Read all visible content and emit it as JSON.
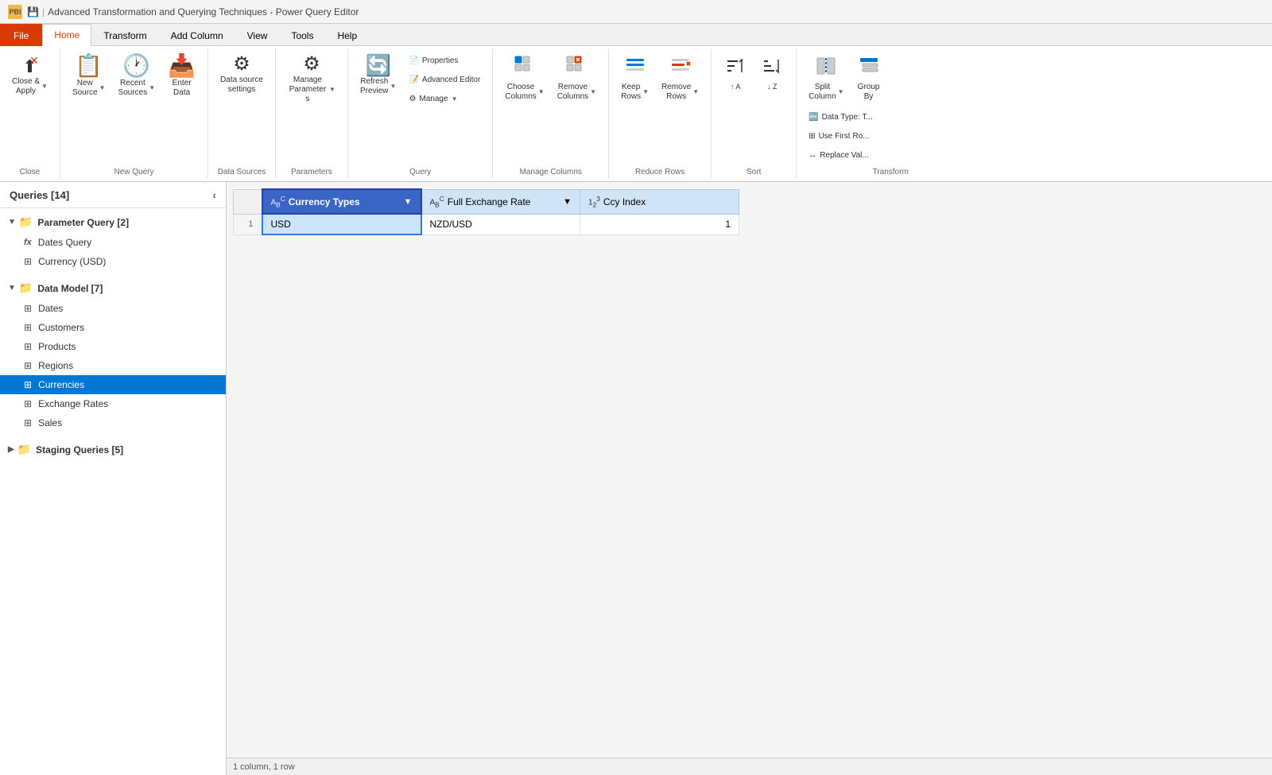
{
  "app": {
    "title": "Advanced Transformation and Querying Techniques - Power Query Editor",
    "logo": "PBI"
  },
  "top_ribbon_icons": [
    "🗃",
    "📊",
    "📋",
    "📁",
    "🔲",
    "⚙",
    "📅",
    "📊",
    "🔗",
    "📈",
    "🔤",
    "🖊",
    "🔢",
    "⚡",
    "🗂",
    "👤"
  ],
  "tabs": [
    {
      "id": "file",
      "label": "File",
      "active": false,
      "is_file": true
    },
    {
      "id": "home",
      "label": "Home",
      "active": true,
      "is_file": false
    },
    {
      "id": "transform",
      "label": "Transform",
      "active": false,
      "is_file": false
    },
    {
      "id": "add_column",
      "label": "Add Column",
      "active": false,
      "is_file": false
    },
    {
      "id": "view",
      "label": "View",
      "active": false,
      "is_file": false
    },
    {
      "id": "tools",
      "label": "Tools",
      "active": false,
      "is_file": false
    },
    {
      "id": "help",
      "label": "Help",
      "active": false,
      "is_file": false
    }
  ],
  "ribbon": {
    "groups": [
      {
        "id": "close",
        "label": "Close",
        "buttons": [
          {
            "id": "close-apply",
            "icon": "✕",
            "label": "Close &\nApply",
            "dropdown": true,
            "large": true
          }
        ]
      },
      {
        "id": "new-query",
        "label": "New Query",
        "buttons": [
          {
            "id": "new-source",
            "icon": "📋",
            "label": "New\nSource",
            "dropdown": true,
            "large": true
          },
          {
            "id": "recent-sources",
            "icon": "🕐",
            "label": "Recent\nSources",
            "dropdown": true,
            "large": true
          },
          {
            "id": "enter-data",
            "icon": "📥",
            "label": "Enter\nData",
            "large": true
          }
        ]
      },
      {
        "id": "data-sources",
        "label": "Data Sources",
        "buttons": [
          {
            "id": "data-source-settings",
            "icon": "⚙",
            "label": "Data source\nsettings",
            "large": true
          }
        ]
      },
      {
        "id": "parameters",
        "label": "Parameters",
        "buttons": [
          {
            "id": "manage-parameters",
            "icon": "⚙",
            "label": "Manage\nParameters",
            "dropdown": true,
            "large": true
          }
        ]
      },
      {
        "id": "query",
        "label": "Query",
        "buttons": [
          {
            "id": "refresh-preview",
            "icon": "🔄",
            "label": "Refresh\nPreview",
            "dropdown": true,
            "large": true
          },
          {
            "id": "properties",
            "icon": "📄",
            "label": "Properties",
            "small": true
          },
          {
            "id": "advanced-editor",
            "icon": "📝",
            "label": "Advanced Editor",
            "small": true
          },
          {
            "id": "manage",
            "icon": "⚙",
            "label": "Manage",
            "dropdown": true,
            "small": true
          }
        ]
      },
      {
        "id": "manage-columns",
        "label": "Manage Columns",
        "buttons": [
          {
            "id": "choose-columns",
            "icon": "⊞",
            "label": "Choose\nColumns",
            "dropdown": true,
            "large": true
          },
          {
            "id": "remove-columns",
            "icon": "✕",
            "label": "Remove\nColumns",
            "dropdown": true,
            "large": true
          }
        ]
      },
      {
        "id": "reduce-rows",
        "label": "Reduce Rows",
        "buttons": [
          {
            "id": "keep-rows",
            "icon": "≡",
            "label": "Keep\nRows",
            "dropdown": true,
            "large": true
          },
          {
            "id": "remove-rows",
            "icon": "✕",
            "label": "Remove\nRows",
            "dropdown": true,
            "large": true,
            "active": true
          }
        ]
      },
      {
        "id": "sort",
        "label": "Sort",
        "buttons": [
          {
            "id": "sort-asc",
            "icon": "↑",
            "label": "Sort\nAsc",
            "large": true
          },
          {
            "id": "sort-desc",
            "icon": "↓",
            "label": "Sort\nDesc",
            "large": true
          }
        ]
      },
      {
        "id": "transform",
        "label": "Transform",
        "buttons": [
          {
            "id": "split-column",
            "icon": "⫘",
            "label": "Split\nColumn",
            "dropdown": true,
            "large": true
          },
          {
            "id": "group-by",
            "icon": "⊟",
            "label": "Group\nBy",
            "large": true
          },
          {
            "id": "data-type",
            "icon": "🔤",
            "label": "Data Type: T",
            "small": true
          },
          {
            "id": "use-first-row",
            "icon": "⊞",
            "label": "Use First...",
            "small": true
          },
          {
            "id": "replace-values",
            "icon": "↔",
            "label": "Replace",
            "small": true
          }
        ]
      }
    ]
  },
  "sidebar": {
    "title": "Queries [14]",
    "groups": [
      {
        "id": "parameter-query",
        "label": "Parameter Query [2]",
        "expanded": true,
        "items": [
          {
            "id": "dates-query",
            "label": "Dates Query",
            "type": "fx"
          },
          {
            "id": "currency-usd",
            "label": "Currency (USD)",
            "type": "table"
          }
        ]
      },
      {
        "id": "data-model",
        "label": "Data Model [7]",
        "expanded": true,
        "items": [
          {
            "id": "dates",
            "label": "Dates",
            "type": "table"
          },
          {
            "id": "customers",
            "label": "Customers",
            "type": "table"
          },
          {
            "id": "products",
            "label": "Products",
            "type": "table"
          },
          {
            "id": "regions",
            "label": "Regions",
            "type": "table"
          },
          {
            "id": "currencies",
            "label": "Currencies",
            "type": "table",
            "active": true
          },
          {
            "id": "exchange-rates",
            "label": "Exchange Rates",
            "type": "table"
          },
          {
            "id": "sales",
            "label": "Sales",
            "type": "table"
          }
        ]
      },
      {
        "id": "staging-queries",
        "label": "Staging Queries [5]",
        "expanded": false,
        "items": []
      }
    ]
  },
  "table": {
    "columns": [
      {
        "id": "currency-types",
        "label": "Currency Types",
        "type": "ABC",
        "filter": true,
        "selected": true
      },
      {
        "id": "full-exchange-rate",
        "label": "Full Exchange Rate",
        "type": "ABC",
        "filter": true,
        "selected": false
      },
      {
        "id": "ccy-index",
        "label": "Ccy Index",
        "type": "123",
        "filter": false,
        "selected": false
      }
    ],
    "rows": [
      {
        "num": 1,
        "currency-types": "USD",
        "full-exchange-rate": "NZD/USD",
        "ccy-index": "1",
        "selected": true
      }
    ]
  },
  "status": "1 column, 1 row"
}
